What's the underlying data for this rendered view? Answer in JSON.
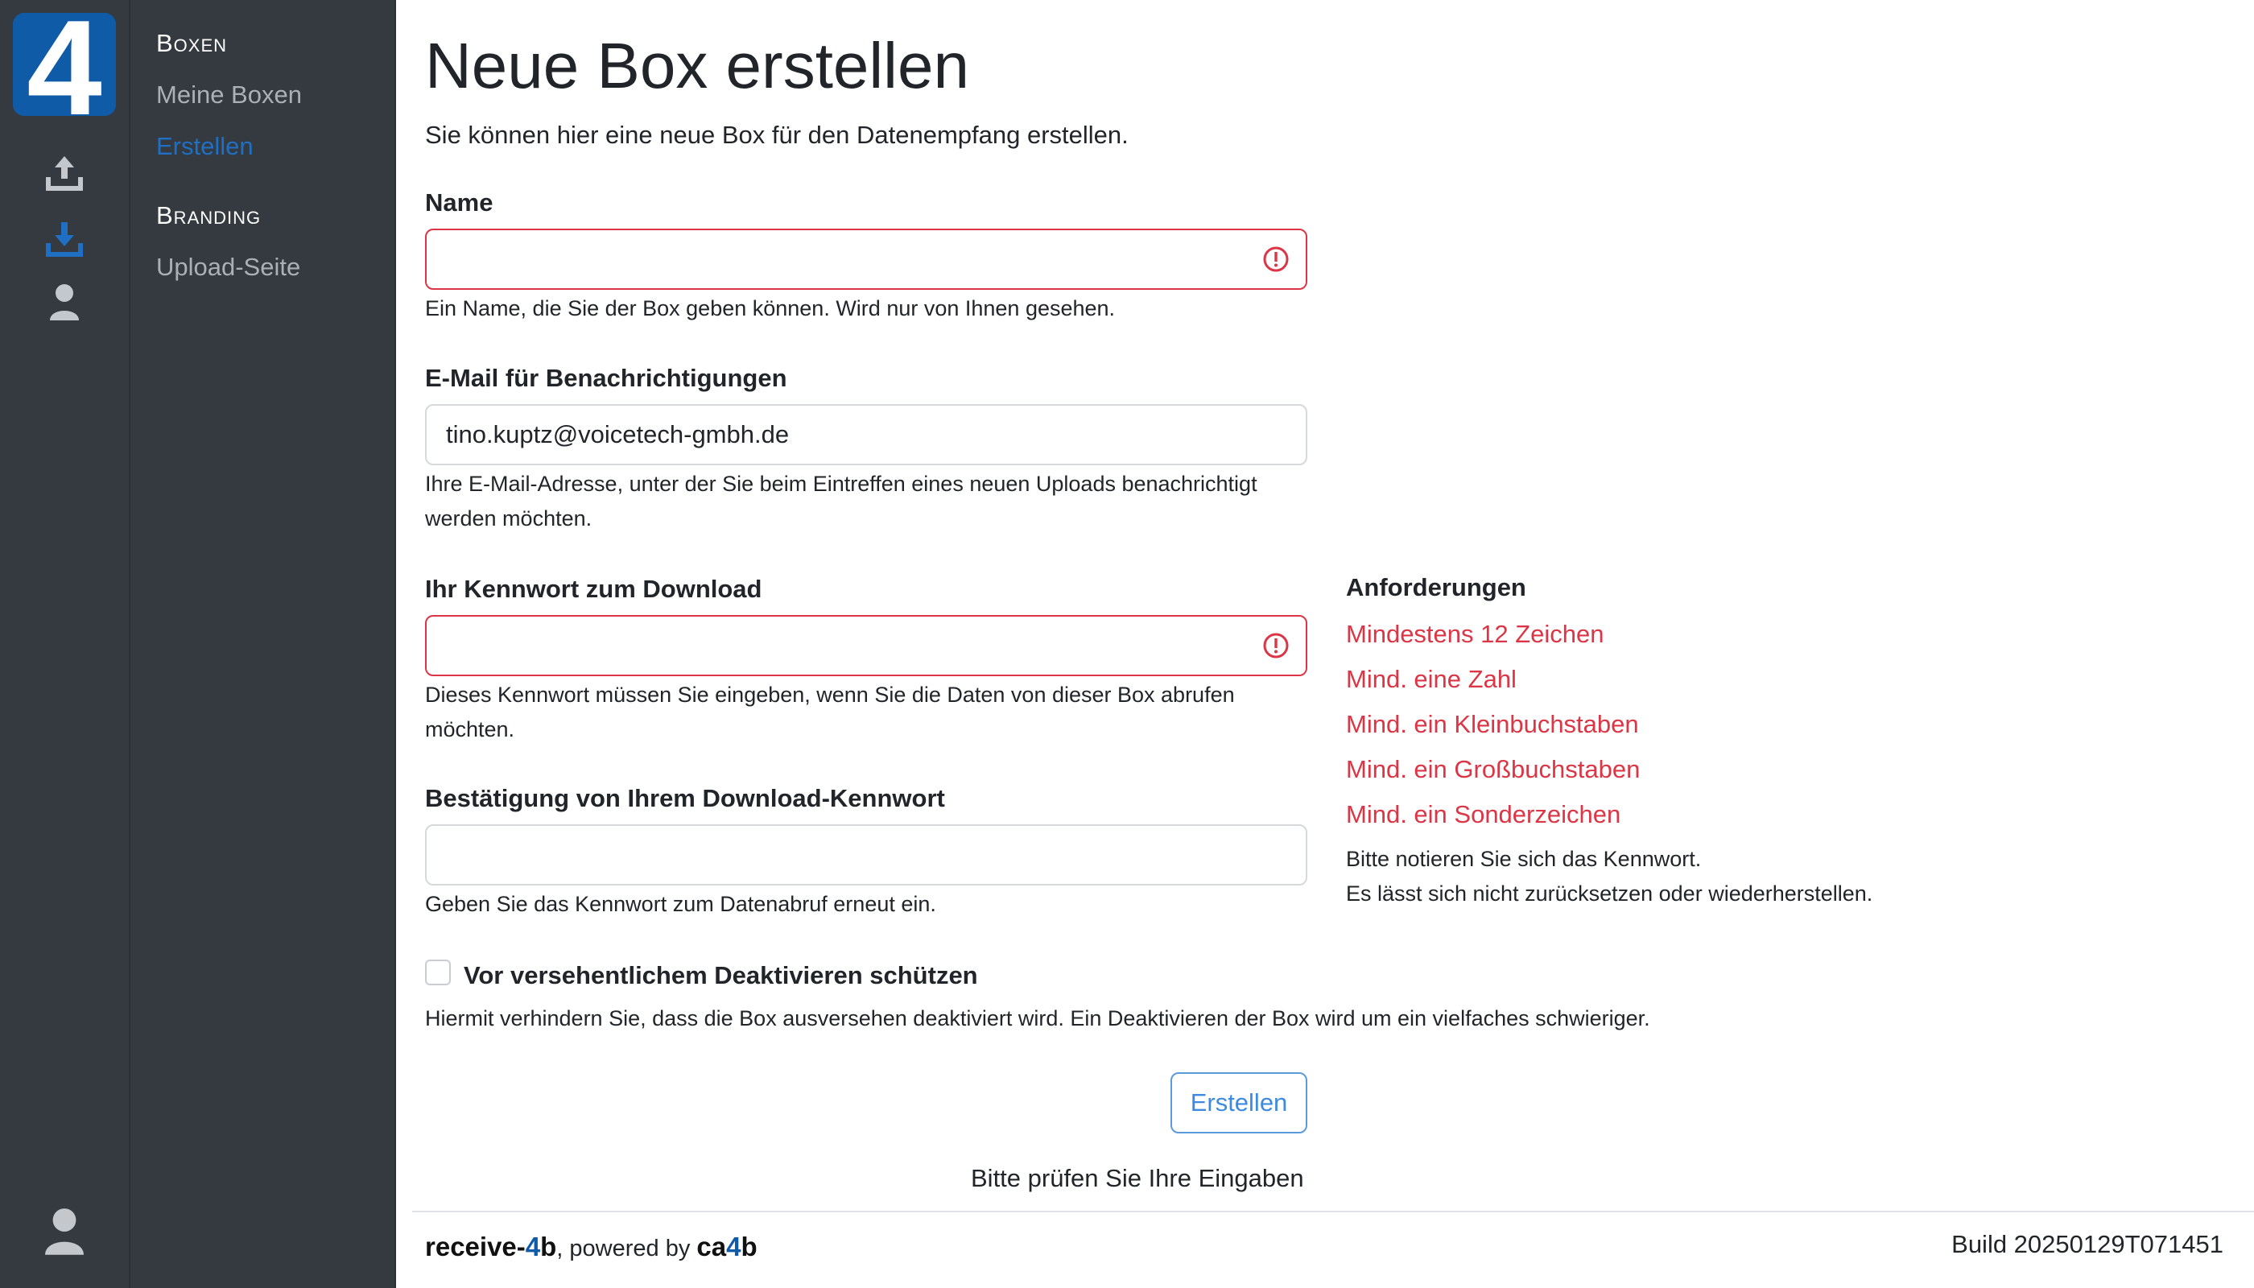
{
  "logo": {
    "glyph": "4"
  },
  "rail": {
    "icons": [
      "upload-icon",
      "download-icon",
      "user-icon",
      "account-icon"
    ],
    "active_color": "#1f6fc4",
    "icon_color": "#c4c8cc"
  },
  "nav": {
    "sections": [
      {
        "heading": "Boxen",
        "items": [
          {
            "label": "Meine Boxen",
            "active": false
          },
          {
            "label": "Erstellen",
            "active": true
          }
        ]
      },
      {
        "heading": "Branding",
        "items": [
          {
            "label": "Upload-Seite",
            "active": false
          }
        ]
      }
    ]
  },
  "page": {
    "title": "Neue Box erstellen",
    "subtitle": "Sie können hier eine neue Box für den Datenempfang erstellen."
  },
  "form": {
    "name": {
      "label": "Name",
      "value": "",
      "help": "Ein Name, die Sie der Box geben können. Wird nur von Ihnen gesehen."
    },
    "email": {
      "label": "E-Mail für Benachrichtigungen",
      "value": "tino.kuptz@voicetech-gmbh.de",
      "help_line1": "Ihre E-Mail-Adresse, unter der Sie beim Eintreffen eines neuen Uploads benachrichtigt",
      "help_line2": "werden möchten."
    },
    "password": {
      "label": "Ihr Kennwort zum Download",
      "value": "",
      "help_line1": "Dieses Kennwort müssen Sie eingeben, wenn Sie die Daten von dieser Box abrufen",
      "help_line2": "möchten."
    },
    "confirm": {
      "label": "Bestätigung von Ihrem Download-Kennwort",
      "value": "",
      "help": "Geben Sie das Kennwort zum Datenabruf erneut ein."
    },
    "protect": {
      "label": "Vor versehentlichem Deaktivieren schützen",
      "checked": false,
      "help": "Hiermit verhindern Sie, dass die Box ausversehen deaktiviert wird. Ein Deaktivieren der Box wird um ein vielfaches schwieriger."
    },
    "submit_label": "Erstellen",
    "validation_message": "Bitte prüfen Sie Ihre Eingaben"
  },
  "requirements": {
    "heading": "Anforderungen",
    "items": [
      "Mindestens 12 Zeichen",
      "Mind. eine Zahl",
      "Mind. ein Kleinbuchstaben",
      "Mind. ein Großbuchstaben",
      "Mind. ein Sonderzeichen"
    ],
    "note_line1": "Bitte notieren Sie sich das Kennwort.",
    "note_line2": "Es lässt sich nicht zurücksetzen oder wiederherstellen.",
    "error_color": "#dc3545"
  },
  "footer": {
    "brand_prefix": "receive-",
    "brand_four": "4",
    "brand_suffix": "b",
    "powered_by": ", powered by ",
    "company_prefix": "ca",
    "company_four": "4",
    "company_suffix": "b",
    "build": "Build 20250129T071451"
  }
}
